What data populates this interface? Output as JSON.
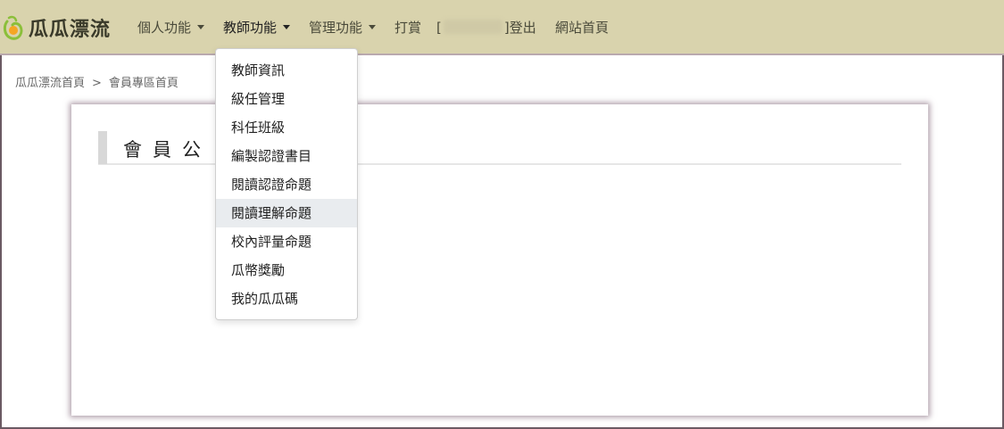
{
  "navbar": {
    "logo_text": "瓜瓜漂流",
    "menus": [
      {
        "label": "個人功能",
        "has_caret": true
      },
      {
        "label": "教師功能",
        "has_caret": true
      },
      {
        "label": "管理功能",
        "has_caret": true
      },
      {
        "label": "打賞",
        "has_caret": false
      }
    ],
    "user_prefix": "[",
    "user_suffix": "]",
    "logout_label": "登出",
    "home_label": "網站首頁"
  },
  "breadcrumb": {
    "items": [
      "瓜瓜漂流首頁",
      "會員專區首頁"
    ],
    "separator": ">"
  },
  "card": {
    "title": "會員公"
  },
  "dropdown": {
    "items": [
      "教師資訊",
      "級任管理",
      "科任班級",
      "編製認證書目",
      "閱讀認證命題",
      "閱讀理解命題",
      "校內評量命題",
      "瓜幣獎勵",
      "我的瓜瓜碼"
    ],
    "highlighted_index": 5
  },
  "colors": {
    "navbar_bg": "#d9d3ad",
    "highlight_bg": "#e9ecef",
    "logo_green": "#7cb342",
    "logo_orange": "#f39c12"
  }
}
